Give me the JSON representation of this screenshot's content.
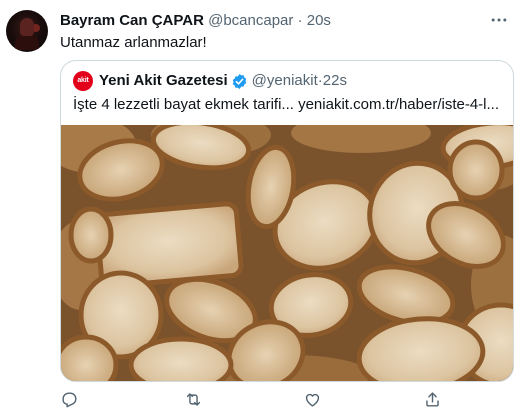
{
  "tweet": {
    "author_name": "Bayram Can ÇAPAR",
    "author_handle": "@bcancapar",
    "separator": "·",
    "time": "20s",
    "text": "Utanmaz arlanmazlar!"
  },
  "quoted_tweet": {
    "avatar_text": "akit",
    "author_name": "Yeni Akit Gazetesi",
    "verified": true,
    "author_handle": "@yeniakit",
    "separator": "·",
    "time": "22s",
    "text": "İşte 4 lezzetli bayat ekmek tarifi... yeniakit.com.tr/haber/iste-4-l...",
    "image_subject": "stale-bread-slices"
  },
  "actions": [
    "reply-icon",
    "retweet-icon",
    "like-icon",
    "share-icon"
  ],
  "colors": {
    "text": "#0f1419",
    "secondary": "#536471",
    "border": "#cfd9de",
    "verified": "#1d9bf0",
    "brand_red": "#e2001a"
  }
}
